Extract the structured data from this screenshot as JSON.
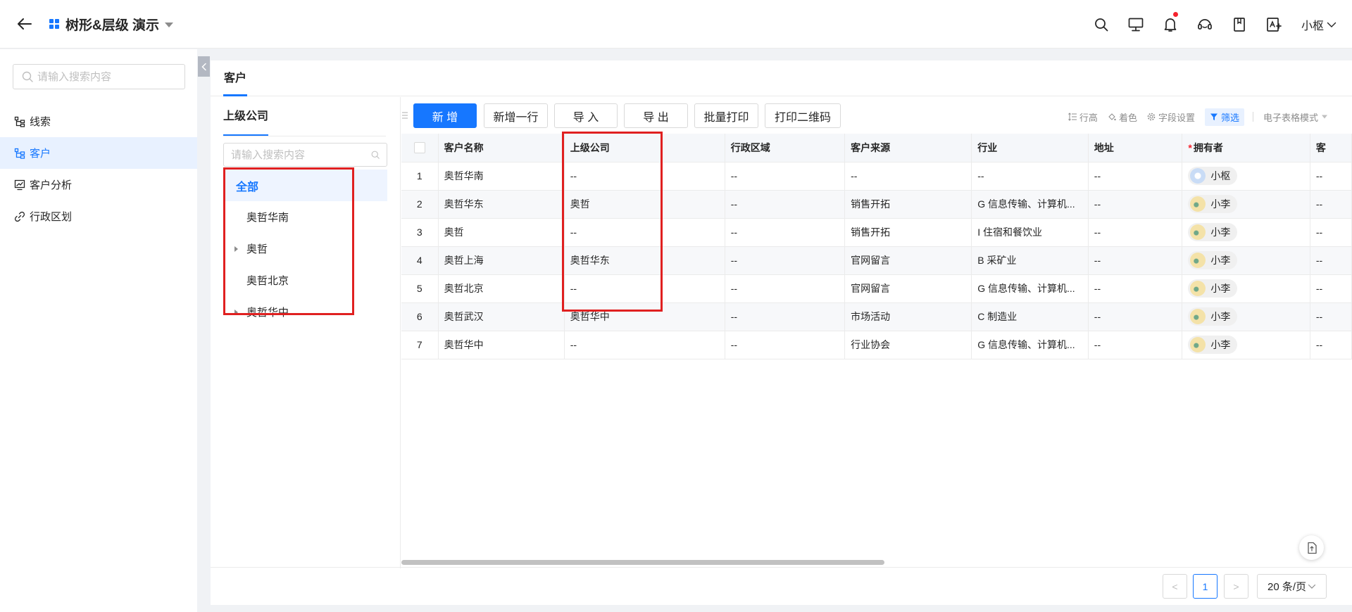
{
  "app": {
    "title": "树形&层级 演示"
  },
  "topbar": {
    "user_name": "小枢"
  },
  "sidebar": {
    "search_placeholder": "请输入搜索内容",
    "items": [
      {
        "label": "线索",
        "icon": "tree-structure-icon"
      },
      {
        "label": "客户",
        "icon": "tree-structure-icon"
      },
      {
        "label": "客户分析",
        "icon": "chart-monitor-icon"
      },
      {
        "label": "行政区划",
        "icon": "link-icon"
      }
    ]
  },
  "main": {
    "tab": "客户"
  },
  "tree": {
    "title": "上级公司",
    "search_placeholder": "请输入搜索内容",
    "nodes": [
      {
        "label": "全部"
      },
      {
        "label": "奥哲华南"
      },
      {
        "label": "奥哲"
      },
      {
        "label": "奥哲北京"
      },
      {
        "label": "奥哲华中"
      }
    ]
  },
  "toolbar": {
    "add": "新 增",
    "add_row": "新增一行",
    "import": "导 入",
    "export": "导 出",
    "batch_print": "批量打印",
    "print_qr": "打印二维码",
    "row_height": "行高",
    "coloring": "着色",
    "field_settings": "字段设置",
    "filter": "筛选",
    "spreadsheet_mode": "电子表格模式"
  },
  "table": {
    "columns": [
      "客户名称",
      "上级公司",
      "行政区域",
      "客户来源",
      "行业",
      "地址",
      "拥有者",
      "客"
    ],
    "rows": [
      {
        "num": "1",
        "name": "奥哲华南",
        "parent": "--",
        "region": "--",
        "source": "--",
        "industry": "--",
        "address": "--",
        "owner": "小枢",
        "extra": "--"
      },
      {
        "num": "2",
        "name": "奥哲华东",
        "parent": "奥哲",
        "region": "--",
        "source": "销售开拓",
        "industry": "G 信息传输、计算机...",
        "address": "--",
        "owner": "小李",
        "extra": "--"
      },
      {
        "num": "3",
        "name": "奥哲",
        "parent": "--",
        "region": "--",
        "source": "销售开拓",
        "industry": "I 住宿和餐饮业",
        "address": "--",
        "owner": "小李",
        "extra": "--"
      },
      {
        "num": "4",
        "name": "奥哲上海",
        "parent": "奥哲华东",
        "region": "--",
        "source": "官网留言",
        "industry": "B 采矿业",
        "address": "--",
        "owner": "小李",
        "extra": "--"
      },
      {
        "num": "5",
        "name": "奥哲北京",
        "parent": "--",
        "region": "--",
        "source": "官网留言",
        "industry": "G 信息传输、计算机...",
        "address": "--",
        "owner": "小李",
        "extra": "--"
      },
      {
        "num": "6",
        "name": "奥哲武汉",
        "parent": "奥哲华中",
        "region": "--",
        "source": "市场活动",
        "industry": "C 制造业",
        "address": "--",
        "owner": "小李",
        "extra": "--"
      },
      {
        "num": "7",
        "name": "奥哲华中",
        "parent": "--",
        "region": "--",
        "source": "行业协会",
        "industry": "G 信息传输、计算机...",
        "address": "--",
        "owner": "小李",
        "extra": "--"
      }
    ]
  },
  "pagination": {
    "current_page": "1",
    "page_size": "20 条/页",
    "prev": "<",
    "next": ">"
  },
  "colors": {
    "accent": "#1677ff",
    "highlight_box": "#e02020"
  }
}
